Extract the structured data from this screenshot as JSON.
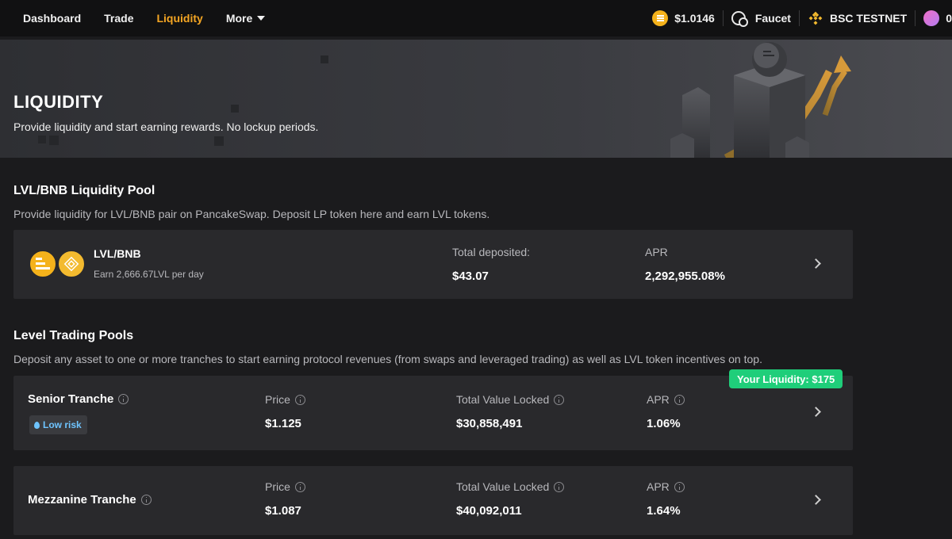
{
  "nav": {
    "items": [
      {
        "label": "Dashboard",
        "active": false
      },
      {
        "label": "Trade",
        "active": false
      },
      {
        "label": "Liquidity",
        "active": true
      },
      {
        "label": "More",
        "active": false
      }
    ],
    "price": "$1.0146",
    "faucet": "Faucet",
    "network": "BSC TESTNET",
    "account_partial": "0"
  },
  "hero": {
    "title": "LIQUIDITY",
    "subtitle": "Provide liquidity and start earning rewards. No lockup periods."
  },
  "lp_section": {
    "title": "LVL/BNB Liquidity Pool",
    "description": "Provide liquidity for LVL/BNB pair on PancakeSwap. Deposit LP token here and earn LVL tokens.",
    "pool": {
      "name": "LVL/BNB",
      "earn": "Earn 2,666.67LVL per day",
      "deposited_label": "Total deposited:",
      "deposited_value": "$43.07",
      "apr_label": "APR",
      "apr_value": "2,292,955.08%"
    }
  },
  "trading_section": {
    "title": "Level Trading Pools",
    "description": "Deposit any asset to one or more tranches to start earning protocol revenues (from swaps and leveraged trading) as well as LVL token incentives on top.",
    "your_liquidity": "Your Liquidity: $175",
    "tranches": [
      {
        "name": "Senior Tranche",
        "risk": "Low risk",
        "price_label": "Price",
        "price": "$1.125",
        "tvl_label": "Total Value Locked",
        "tvl": "$30,858,491",
        "apr_label": "APR",
        "apr": "1.06%"
      },
      {
        "name": "Mezzanine Tranche",
        "price_label": "Price",
        "price": "$1.087",
        "tvl_label": "Total Value Locked",
        "tvl": "$40,092,011",
        "apr_label": "APR",
        "apr": "1.64%"
      }
    ]
  },
  "colors": {
    "accent": "#f5a623",
    "success": "#1fce7a",
    "risk_low": "#6ec4ff",
    "bnb": "#f3ba2f"
  }
}
